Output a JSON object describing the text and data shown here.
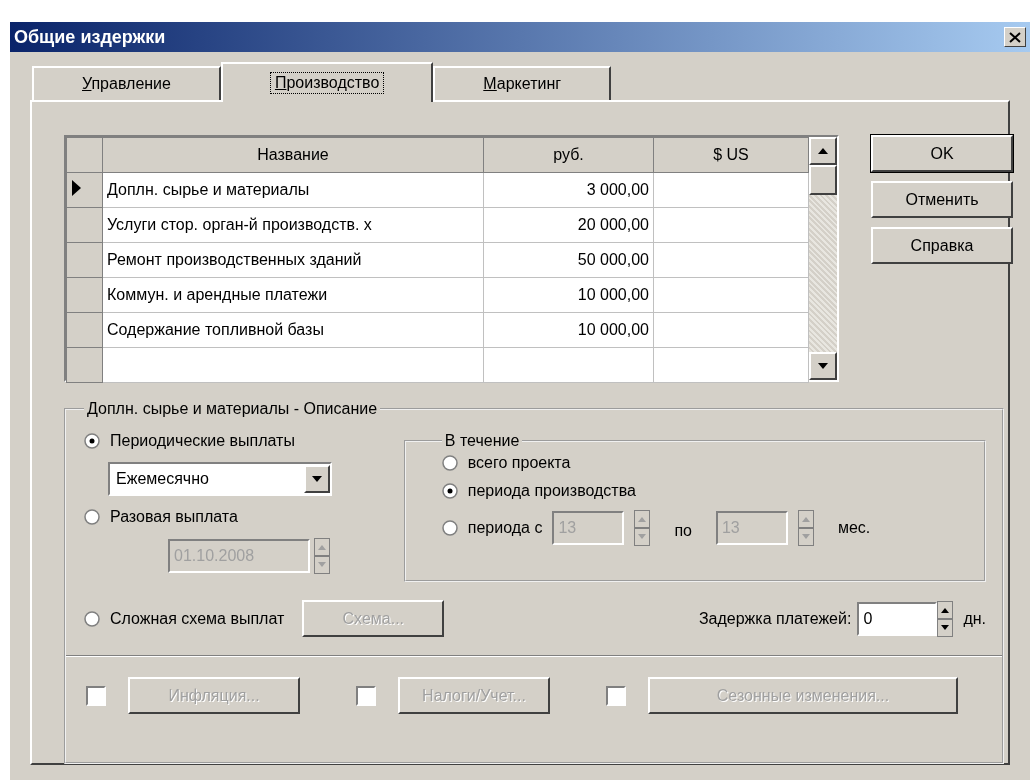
{
  "window": {
    "title": "Общие издержки"
  },
  "tabs": [
    {
      "label": "Управление",
      "selected": false
    },
    {
      "label": "Производство",
      "selected": true
    },
    {
      "label": "Маркетинг",
      "selected": false
    }
  ],
  "table": {
    "columns": [
      "Название",
      "руб.",
      "$ US"
    ],
    "rows": [
      {
        "name": "Доплн. сырье и материалы",
        "rub": "3 000,00",
        "current": true
      },
      {
        "name": "Услуги стор. орган-й производств. х",
        "rub": "20 000,00",
        "current": false
      },
      {
        "name": "Ремонт производственных зданий",
        "rub": "50 000,00",
        "current": false
      },
      {
        "name": "Коммун. и арендные платежи",
        "rub": "10 000,00",
        "current": false
      },
      {
        "name": "Содержание топливной базы",
        "rub": "10 000,00",
        "current": false
      }
    ]
  },
  "buttons": [
    "OK",
    "Отменить",
    "Справка"
  ],
  "description": {
    "title": "Доплн. сырье и материалы - Описание",
    "payment_options": [
      {
        "kind": "periodic",
        "label": "Периодические выплаты",
        "selected": true,
        "value": "Ежемесячно"
      },
      {
        "kind": "single",
        "label": "Разовая выплата",
        "selected": false,
        "value": "01.10.2008",
        "disabled": true
      },
      {
        "kind": "complex",
        "label": "Сложная схема выплат",
        "selected": false,
        "button": "Схема...",
        "disabled": true
      }
    ],
    "duration": {
      "title": "В течение",
      "options": [
        {
          "kind": "plain",
          "label": "всего проекта",
          "selected": false
        },
        {
          "kind": "plain",
          "label": "периода производства",
          "selected": true
        },
        {
          "kind": "range",
          "label": "периода с",
          "selected": false,
          "from": "13",
          "to_label": "по",
          "to": "13",
          "unit": "мес.",
          "disabled": true
        }
      ]
    },
    "delay": {
      "label": "Задержка платежей:",
      "value": "0",
      "unit": "дн."
    }
  },
  "options": [
    {
      "label": "Инфляция...",
      "checked": false,
      "disabled": true
    },
    {
      "label": "Налоги/Учет...",
      "checked": false,
      "disabled": true
    },
    {
      "label": "Сезонные изменения...",
      "checked": false,
      "disabled": true
    }
  ]
}
